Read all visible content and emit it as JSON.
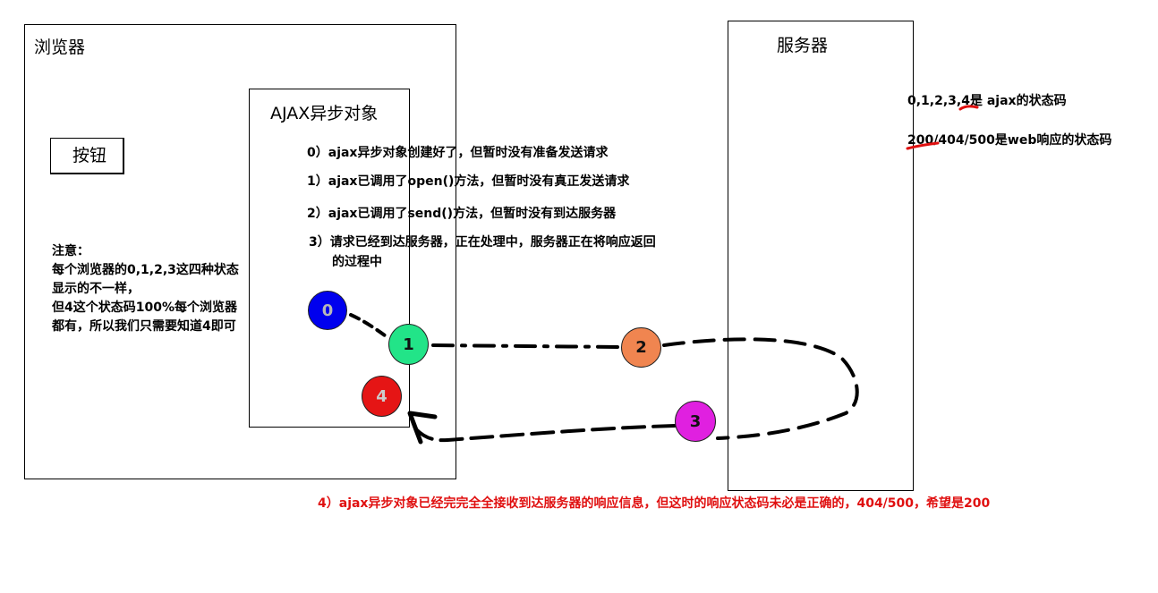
{
  "browser": {
    "title": "浏览器",
    "button_label": "按钮",
    "note": {
      "heading": "注意：",
      "lines": [
        "每个浏览器的0,1,2,3这四种状态",
        "显示的不一样，",
        "但4这个状态码100%每个浏览器",
        "都有，所以我们只需要知道4即可"
      ]
    }
  },
  "ajax": {
    "title": "AJAX异步对象",
    "states": {
      "s0": "0）ajax异步对象创建好了，但暂时没有准备发送请求",
      "s1": "1）ajax已调用了open()方法，但暂时没有真正发送请求",
      "s2": "2）ajax已调用了send()方法，但暂时没有到达服务器",
      "s3_line1": "3）请求已经到达服务器，正在处理中，服务器正在将响应返回",
      "s3_line2": "的过程中",
      "s4": "4）ajax异步对象已经完完全全接收到达服务器的响应信息，但这时的响应状态码未必是正确的，404/500，希望是200"
    }
  },
  "server": {
    "title": "服务器"
  },
  "codes_note": {
    "ajax_codes": "0,1,2,3,4",
    "ajax_codes_suffix": "是 ajax的状态码",
    "web_code_highlight": "200",
    "web_codes_rest": "/404/500是web响应的状态码"
  },
  "circles": {
    "c0": "0",
    "c1": "1",
    "c2": "2",
    "c3": "3",
    "c4": "4"
  },
  "colors": {
    "state0": "#0000ee",
    "state1": "#22e488",
    "state2": "#f08550",
    "state3": "#e020e0",
    "state4": "#e51515",
    "underline": "#e01010",
    "state4_text": "#e01010"
  }
}
